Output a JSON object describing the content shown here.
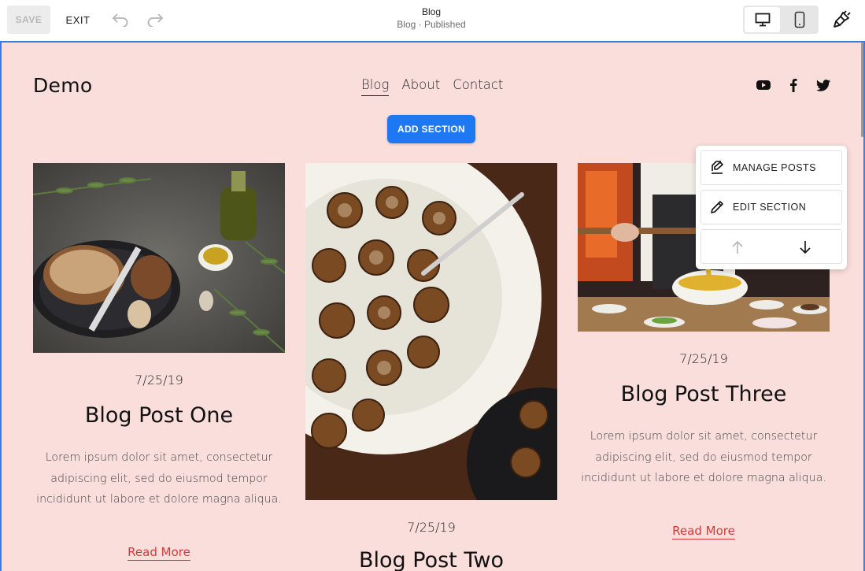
{
  "toolbar": {
    "save_label": "SAVE",
    "exit_label": "EXIT",
    "page_title": "Blog",
    "page_status": "Blog · Published"
  },
  "site": {
    "logo": "Demo",
    "nav": [
      {
        "label": "Blog",
        "active": true
      },
      {
        "label": "About",
        "active": false
      },
      {
        "label": "Contact",
        "active": false
      }
    ],
    "socials": [
      "youtube-icon",
      "facebook-icon",
      "twitter-icon"
    ],
    "add_section_label": "ADD SECTION"
  },
  "posts": [
    {
      "date": "7/25/19",
      "title": "Blog Post One",
      "excerpt": "Lorem ipsum dolor sit amet, consectetur adipiscing elit, sed do eiusmod tempor incididunt ut labore et dolore magna aliqua.",
      "read_more": "Read More"
    },
    {
      "date": "7/25/19",
      "title": "Blog Post Two"
    },
    {
      "date": "7/25/19",
      "title": "Blog Post Three",
      "excerpt": "Lorem ipsum dolor sit amet, consectetur adipiscing elit, sed do eiusmod tempor incididunt ut labore et dolore magna aliqua.",
      "read_more": "Read More"
    }
  ],
  "section_menu": {
    "manage_posts": "MANAGE POSTS",
    "edit_section": "EDIT SECTION"
  },
  "colors": {
    "canvas_bg": "#f9dedb",
    "accent_blue": "#1e78f2",
    "link_red": "#d23a3a",
    "selection_border": "#3b7ddd"
  }
}
